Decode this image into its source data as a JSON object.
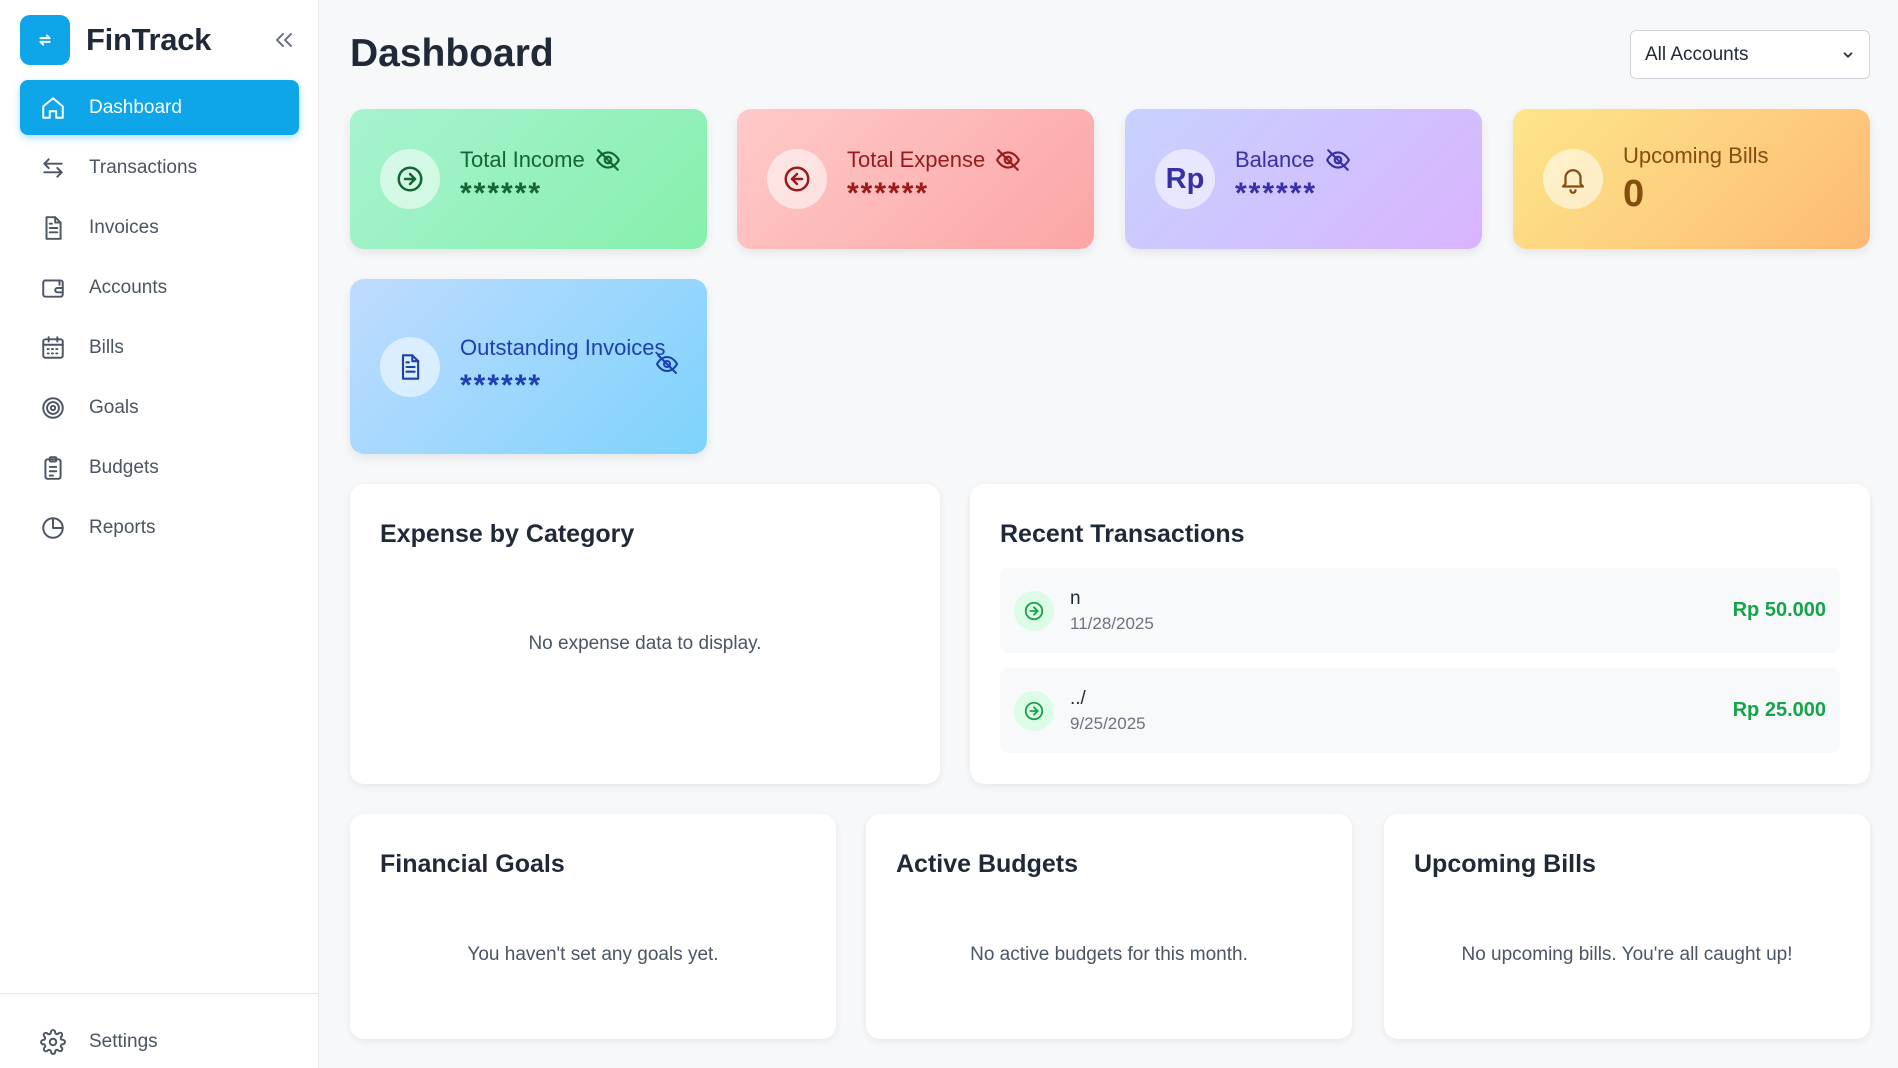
{
  "app": {
    "name": "FinTrack"
  },
  "sidebar": {
    "items": [
      {
        "label": "Dashboard",
        "icon": "home-icon",
        "active": true
      },
      {
        "label": "Transactions",
        "icon": "arrows-swap-icon"
      },
      {
        "label": "Invoices",
        "icon": "document-icon"
      },
      {
        "label": "Accounts",
        "icon": "wallet-icon"
      },
      {
        "label": "Bills",
        "icon": "calendar-icon"
      },
      {
        "label": "Goals",
        "icon": "target-icon"
      },
      {
        "label": "Budgets",
        "icon": "clipboard-icon"
      },
      {
        "label": "Reports",
        "icon": "pie-chart-icon"
      }
    ],
    "settings": {
      "label": "Settings",
      "icon": "gear-icon"
    }
  },
  "header": {
    "title": "Dashboard",
    "account_filter": {
      "selected": "All Accounts"
    }
  },
  "stats": {
    "income": {
      "label": "Total Income",
      "value": "******",
      "icon": "arrow-right-circle-icon"
    },
    "expense": {
      "label": "Total Expense",
      "value": "******",
      "icon": "arrow-left-circle-icon"
    },
    "balance": {
      "label": "Balance",
      "value": "******",
      "icon_text": "Rp"
    },
    "bills": {
      "label": "Upcoming Bills",
      "value": "0",
      "icon": "bell-icon"
    },
    "outstanding": {
      "label": "Outstanding Invoices",
      "value": "******",
      "icon": "document-icon"
    }
  },
  "expense_by_category": {
    "title": "Expense by Category",
    "empty": "No expense data to display."
  },
  "recent_transactions": {
    "title": "Recent Transactions",
    "items": [
      {
        "description": "n",
        "date": "11/28/2025",
        "amount": "Rp 50.000"
      },
      {
        "description": "../",
        "date": "9/25/2025",
        "amount": "Rp 25.000"
      }
    ]
  },
  "financial_goals": {
    "title": "Financial Goals",
    "empty": "You haven't set any goals yet."
  },
  "active_budgets": {
    "title": "Active Budgets",
    "empty": "No active budgets for this month."
  },
  "upcoming_bills": {
    "title": "Upcoming Bills",
    "empty": "No upcoming bills. You're all caught up!"
  },
  "colors": {
    "accent": "#0ea5e9",
    "income": "#166534",
    "expense": "#991b1b",
    "balance": "#3730a3",
    "bills": "#854d0e",
    "outstanding": "#1e40af",
    "amount_positive": "#16a34a"
  }
}
